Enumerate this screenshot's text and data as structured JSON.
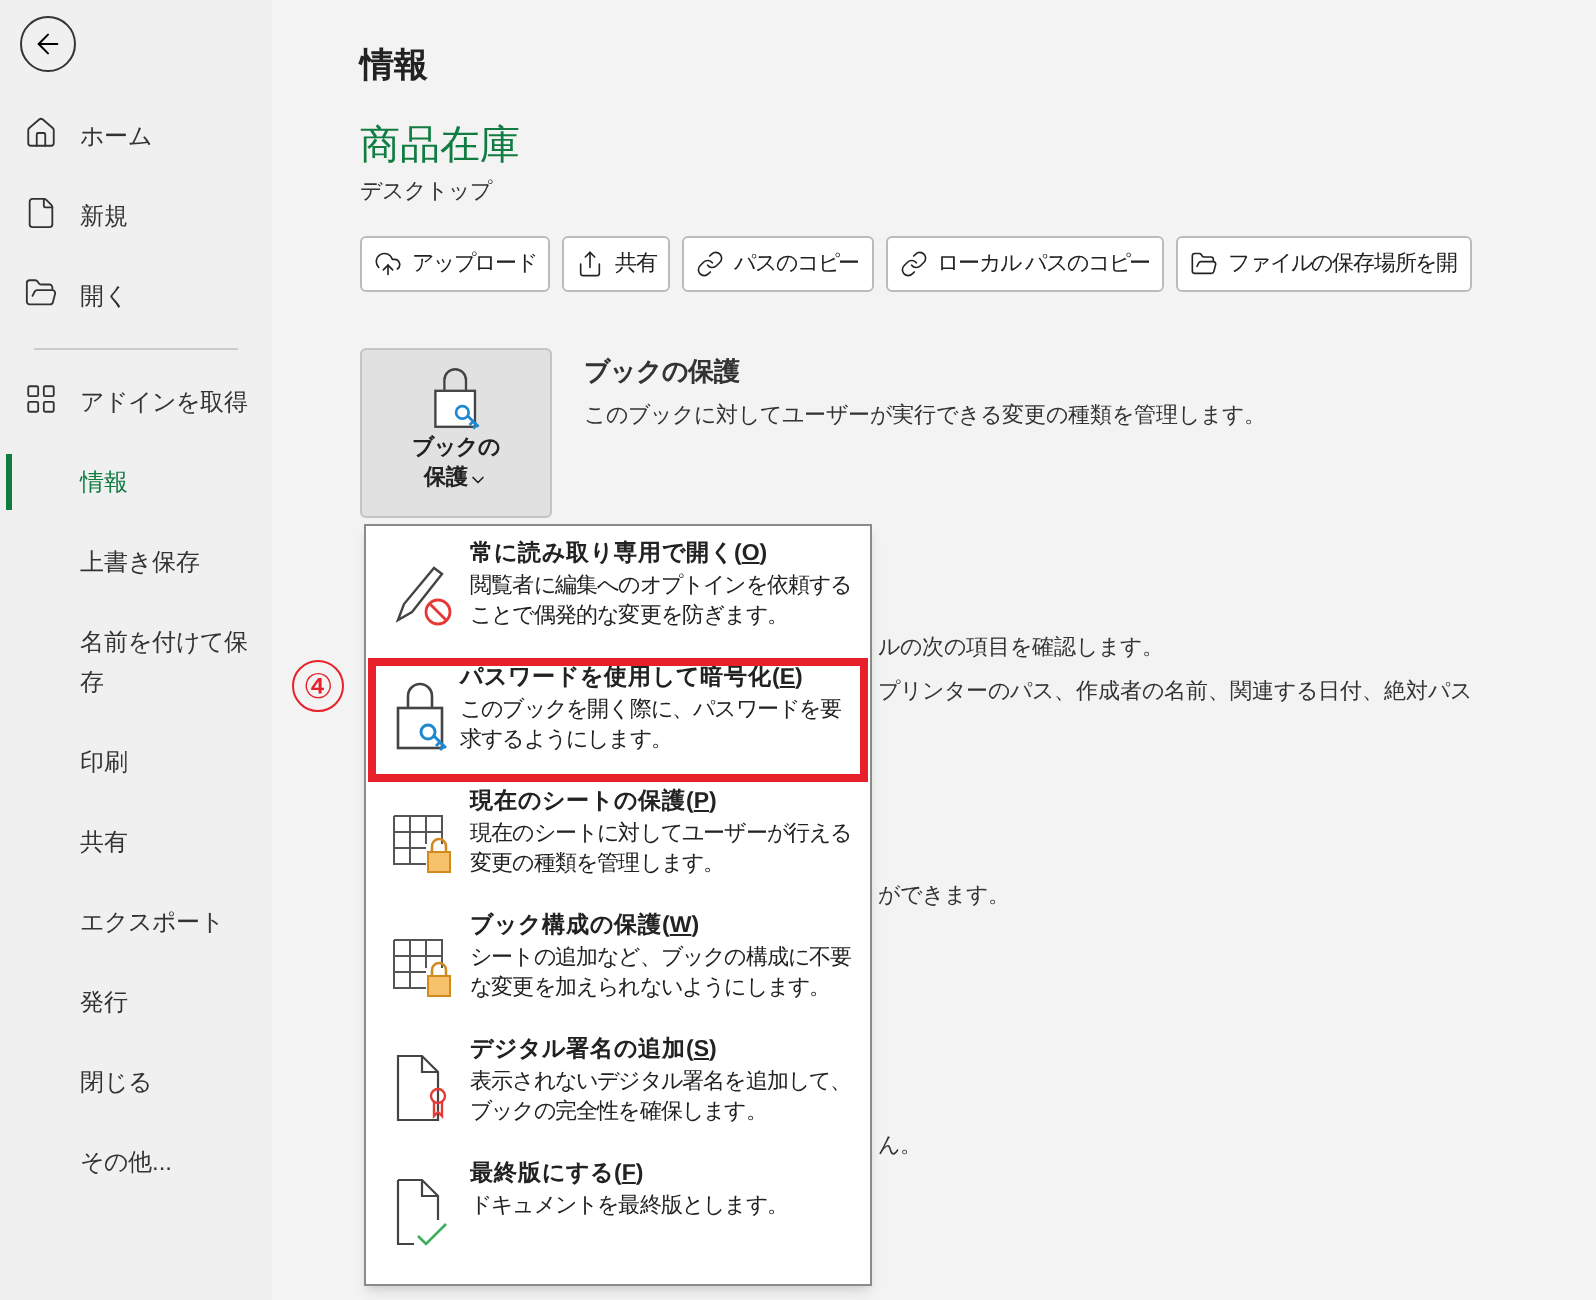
{
  "sidebar": {
    "top_items": [
      {
        "label": "ホーム",
        "selected": false
      },
      {
        "label": "新規",
        "selected": false
      },
      {
        "label": "開く",
        "selected": false
      }
    ],
    "items": [
      {
        "label": "アドインを取得",
        "selected": false
      },
      {
        "label": "情報",
        "selected": true
      },
      {
        "label": "上書き保存",
        "selected": false
      },
      {
        "label": "名前を付けて保存",
        "selected": false
      },
      {
        "label": "印刷",
        "selected": false
      },
      {
        "label": "共有",
        "selected": false
      },
      {
        "label": "エクスポート",
        "selected": false
      },
      {
        "label": "発行",
        "selected": false
      },
      {
        "label": "閉じる",
        "selected": false
      },
      {
        "label": "その他..."
      }
    ]
  },
  "page_title": "情報",
  "document": {
    "name": "商品在庫",
    "location": "デスクトップ"
  },
  "actions": [
    "アップロード",
    "共有",
    "パスのコピー",
    "ローカル パスのコピー",
    "ファイルの保存場所を開"
  ],
  "protect": {
    "button_line1": "ブックの",
    "button_line2": "保護",
    "title": "ブックの保護",
    "description": "このブックに対してユーザーが実行できる変更の種類を管理します。"
  },
  "background_fragments": [
    "ルの次の項目を確認します。",
    "プリンターのパス、作成者の名前、関連する日付、絶対パス",
    "ができます。",
    "ん。"
  ],
  "step_marker": "④",
  "menu": [
    {
      "label": "常に読み取り専用で開く(",
      "access_key": "O",
      "label_end": ")",
      "description": "閲覧者に編集へのオプトインを依頼することで偶発的な変更を防ぎます。",
      "highlighted": false
    },
    {
      "label": "パスワードを使用して暗号化(",
      "access_key": "E",
      "label_end": ")",
      "description": "このブックを開く際に、パスワードを要求するようにします。",
      "highlighted": true
    },
    {
      "label": "現在のシートの保護(",
      "access_key": "P",
      "label_end": ")",
      "description": "現在のシートに対してユーザーが行える変更の種類を管理します。",
      "highlighted": false
    },
    {
      "label": "ブック構成の保護(",
      "access_key": "W",
      "label_end": ")",
      "description": "シートの追加など、ブックの構成に不要な変更を加えられないようにします。",
      "highlighted": false
    },
    {
      "label": "デジタル署名の追加(",
      "access_key": "S",
      "label_end": ")",
      "description": "表示されないデジタル署名を追加して、ブックの完全性を確保します。",
      "highlighted": false
    },
    {
      "label": "最終版にする(",
      "access_key": "F",
      "label_end": ")",
      "description": "ドキュメントを最終版とします。",
      "highlighted": false
    }
  ]
}
